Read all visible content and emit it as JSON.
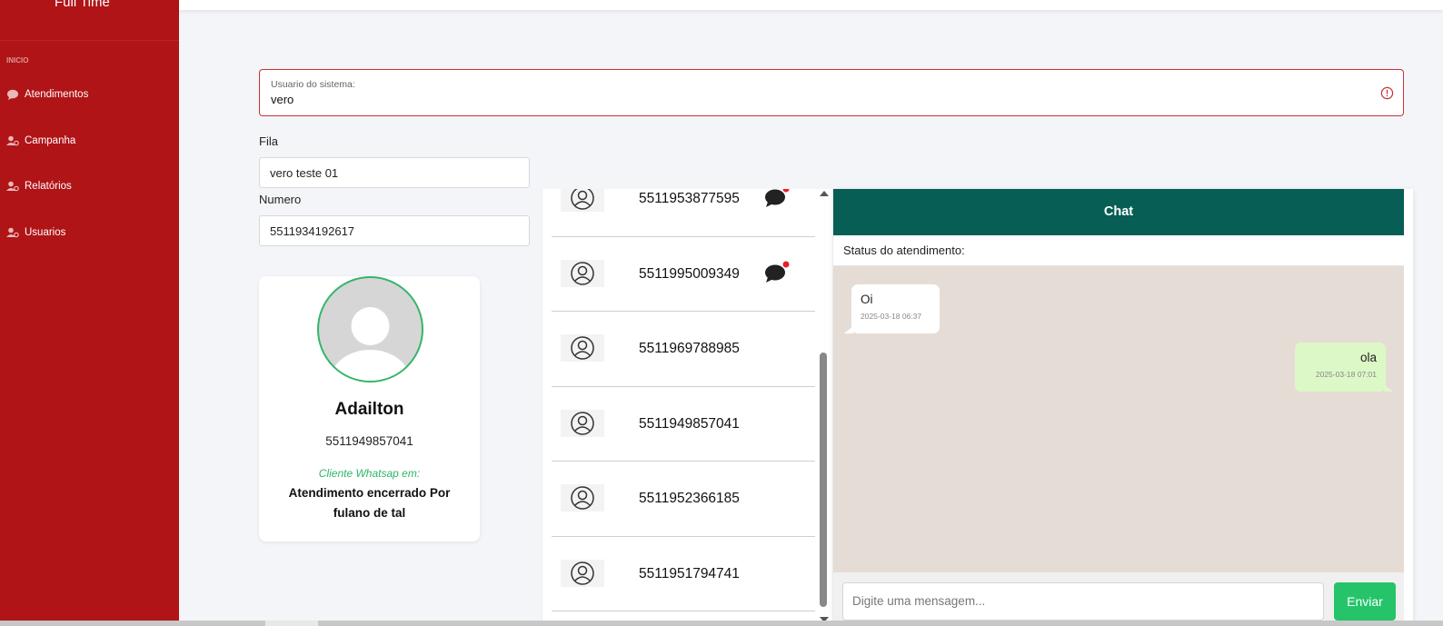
{
  "sidebar": {
    "brand": "Full Time",
    "section": "INICIO",
    "items": [
      {
        "label": "Atendimentos",
        "icon": "chat-bubble-icon"
      },
      {
        "label": "Campanha",
        "icon": "users-icon"
      },
      {
        "label": "Relatórios",
        "icon": "users-icon"
      },
      {
        "label": "Usuarios",
        "icon": "users-icon"
      }
    ]
  },
  "system_user": {
    "label": "Usuario do sistema:",
    "value": "vero"
  },
  "fila": {
    "label": "Fila",
    "value": "vero teste 01"
  },
  "numero": {
    "label": "Numero",
    "value": "5511934192617"
  },
  "profile": {
    "name": "Adailton",
    "phone": "5511949857041",
    "subtitle": "Cliente Whatsap em:",
    "status": "Atendimento encerrado Por fulano de tal"
  },
  "contacts": [
    {
      "number": "5511953877595",
      "has_notification": true
    },
    {
      "number": "5511995009349",
      "has_notification": true
    },
    {
      "number": "5511969788985",
      "has_notification": false
    },
    {
      "number": "5511949857041",
      "has_notification": false
    },
    {
      "number": "5511952366185",
      "has_notification": false
    },
    {
      "number": "5511951794741",
      "has_notification": false
    }
  ],
  "chat": {
    "title": "Chat",
    "status_label": "Status do atendimento:",
    "messages": [
      {
        "direction": "in",
        "text": "Oi",
        "time": "2025-03-18 06:37"
      },
      {
        "direction": "out",
        "text": "ola",
        "time": "2025-03-18 07:01"
      }
    ],
    "input_placeholder": "Digite uma mensagem...",
    "send_label": "Enviar"
  },
  "colors": {
    "sidebar": "#b01417",
    "chat_header": "#075e54",
    "send_button": "#25c46a",
    "avatar_border": "#36b56a",
    "notification_dot": "#e8202a"
  }
}
